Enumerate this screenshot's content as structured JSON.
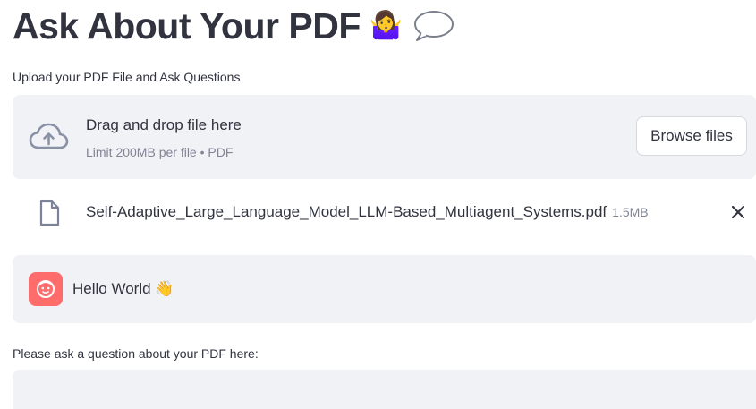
{
  "header": {
    "title": "Ask About Your PDF",
    "emoji_shrug": "🤷‍♀️",
    "emoji_speech": "💭"
  },
  "uploader": {
    "label": "Upload your PDF File and Ask Questions",
    "drag_text": "Drag and drop file here",
    "limit_text": "Limit 200MB per file • PDF",
    "browse_label": "Browse files",
    "icon": "cloud-upload-icon"
  },
  "uploaded_file": {
    "name": "Self-Adaptive_Large_Language_Model_LLM-Based_Multiagent_Systems.pdf",
    "size": "1.5MB",
    "icon": "file-icon",
    "remove_icon": "close-icon"
  },
  "chat": {
    "message": "Hello World",
    "message_emoji": "👋",
    "avatar_color": "#ff6c6c"
  },
  "question": {
    "label": "Please ask a question about your PDF here:",
    "value": "",
    "placeholder": ""
  },
  "colors": {
    "text": "#31333f",
    "muted": "#808495",
    "panel": "#f0f2f6",
    "icon": "#6f7790"
  }
}
